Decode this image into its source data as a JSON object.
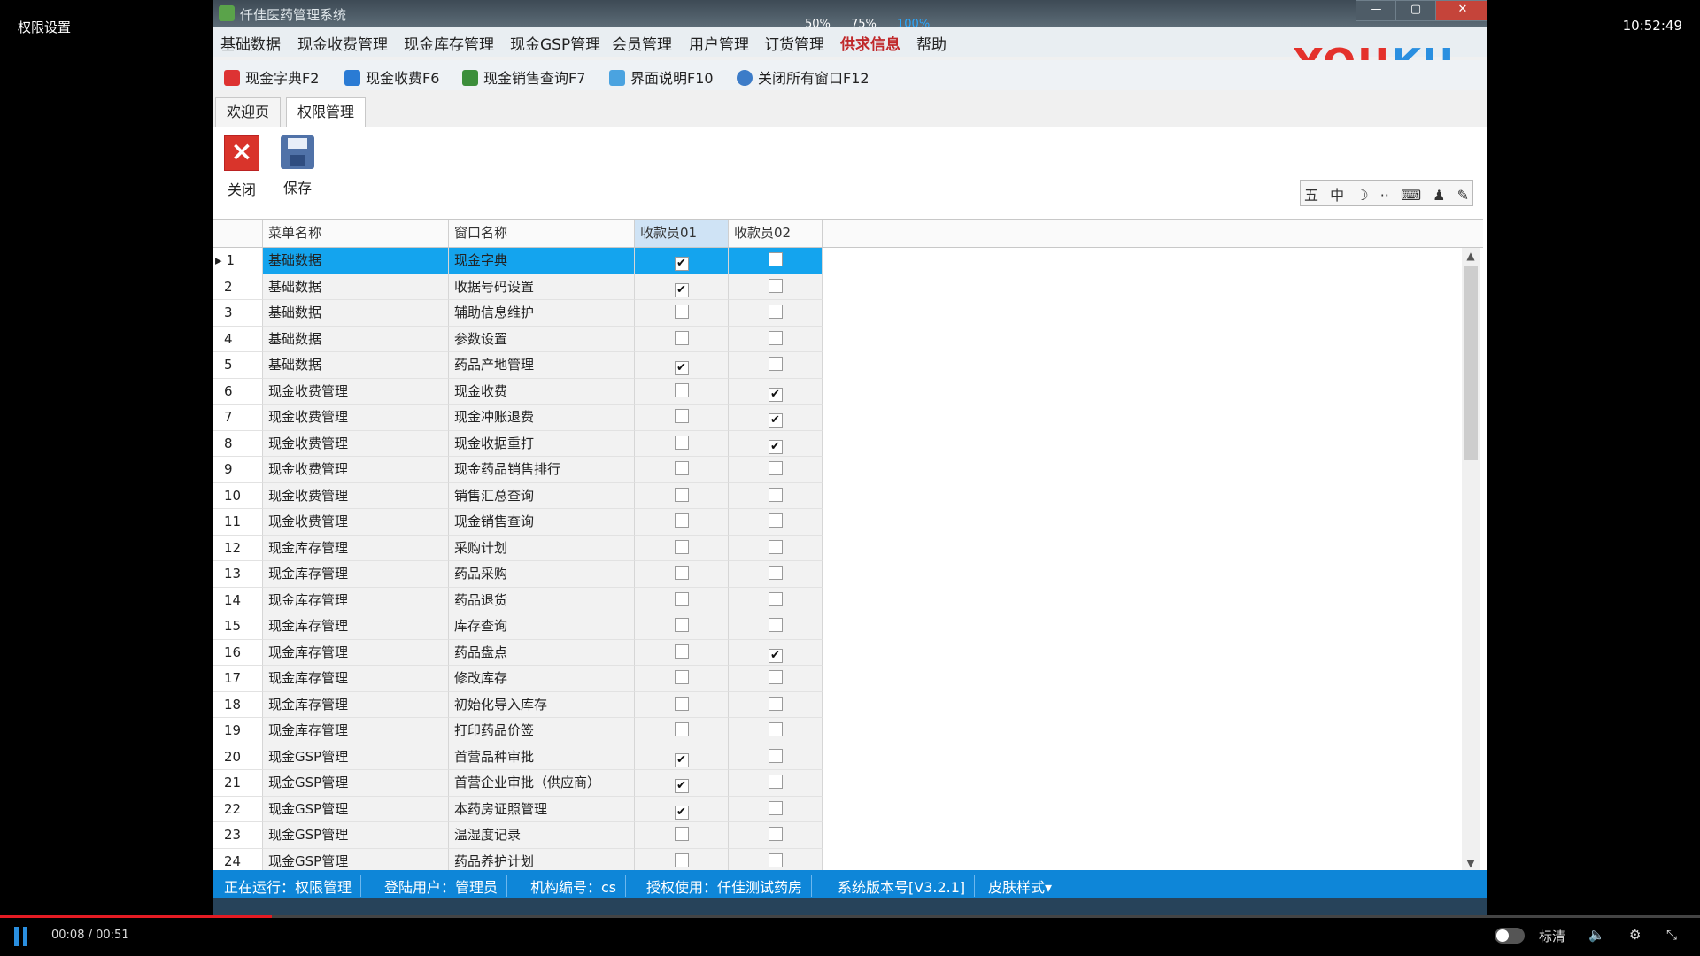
{
  "player": {
    "title": "权限设置",
    "clock": "10:52:49",
    "time": "00:08",
    "duration": "00:51",
    "quality": "标清",
    "progress": 0.16
  },
  "window": {
    "title": "仟佳医药管理系统",
    "zoom": [
      "50%",
      "75%",
      "100%"
    ],
    "controls": [
      "—",
      "▢",
      "✕"
    ]
  },
  "menu": [
    "基础数据",
    "现金收费管理",
    "现金库存管理",
    "现金GSP管理",
    "会员管理",
    "用户管理",
    "订货管理",
    "供求信息",
    "帮助"
  ],
  "brand": {
    "logo": "YOUKU",
    "colors": {
      "you": "#e4312b",
      "ku": "#2a8fe0"
    }
  },
  "quickbar": [
    {
      "label": "现金字典F2",
      "color": "#d33"
    },
    {
      "label": "现金收费F6",
      "color": "#2a7bd4"
    },
    {
      "label": "现金销售查询F7",
      "color": "#3b8e3b"
    },
    {
      "label": "界面说明F10",
      "color": "#4aa3e0"
    },
    {
      "label": "关闭所有窗口F12",
      "color": "#3c7cc8"
    }
  ],
  "tabs": [
    "欢迎页",
    "权限管理"
  ],
  "toolbar": {
    "close": "关闭",
    "save": "保存"
  },
  "ime": [
    "五",
    "中",
    "☽",
    "··",
    "⌨",
    "♟",
    "✎"
  ],
  "table": {
    "headers": [
      "菜单名称",
      "窗口名称",
      "收款员01",
      "收款员02"
    ],
    "rows": [
      {
        "n": "1",
        "menu": "基础数据",
        "win": "现金字典",
        "a": "✔",
        "b": ""
      },
      {
        "n": "2",
        "menu": "基础数据",
        "win": "收据号码设置",
        "a": "✔",
        "b": ""
      },
      {
        "n": "3",
        "menu": "基础数据",
        "win": "辅助信息维护",
        "a": "",
        "b": ""
      },
      {
        "n": "4",
        "menu": "基础数据",
        "win": "参数设置",
        "a": "",
        "b": ""
      },
      {
        "n": "5",
        "menu": "基础数据",
        "win": "药品产地管理",
        "a": "✔",
        "b": ""
      },
      {
        "n": "6",
        "menu": "现金收费管理",
        "win": "现金收费",
        "a": "",
        "b": "✔"
      },
      {
        "n": "7",
        "menu": "现金收费管理",
        "win": "现金冲账退费",
        "a": "",
        "b": "✔"
      },
      {
        "n": "8",
        "menu": "现金收费管理",
        "win": "现金收据重打",
        "a": "",
        "b": "✔"
      },
      {
        "n": "9",
        "menu": "现金收费管理",
        "win": "现金药品销售排行",
        "a": "",
        "b": ""
      },
      {
        "n": "10",
        "menu": "现金收费管理",
        "win": "销售汇总查询",
        "a": "",
        "b": ""
      },
      {
        "n": "11",
        "menu": "现金收费管理",
        "win": "现金销售查询",
        "a": "",
        "b": ""
      },
      {
        "n": "12",
        "menu": "现金库存管理",
        "win": "采购计划",
        "a": "",
        "b": ""
      },
      {
        "n": "13",
        "menu": "现金库存管理",
        "win": "药品采购",
        "a": "",
        "b": ""
      },
      {
        "n": "14",
        "menu": "现金库存管理",
        "win": "药品退货",
        "a": "",
        "b": ""
      },
      {
        "n": "15",
        "menu": "现金库存管理",
        "win": "库存查询",
        "a": "",
        "b": ""
      },
      {
        "n": "16",
        "menu": "现金库存管理",
        "win": "药品盘点",
        "a": "",
        "b": "✔"
      },
      {
        "n": "17",
        "menu": "现金库存管理",
        "win": "修改库存",
        "a": "",
        "b": ""
      },
      {
        "n": "18",
        "menu": "现金库存管理",
        "win": "初始化导入库存",
        "a": "",
        "b": ""
      },
      {
        "n": "19",
        "menu": "现金库存管理",
        "win": "打印药品价签",
        "a": "",
        "b": ""
      },
      {
        "n": "20",
        "menu": "现金GSP管理",
        "win": "首营品种审批",
        "a": "✔",
        "b": ""
      },
      {
        "n": "21",
        "menu": "现金GSP管理",
        "win": "首营企业审批（供应商）",
        "a": "✔",
        "b": ""
      },
      {
        "n": "22",
        "menu": "现金GSP管理",
        "win": "本药房证照管理",
        "a": "✔",
        "b": ""
      },
      {
        "n": "23",
        "menu": "现金GSP管理",
        "win": "温湿度记录",
        "a": "",
        "b": ""
      },
      {
        "n": "24",
        "menu": "现金GSP管理",
        "win": "药品养护计划",
        "a": "",
        "b": ""
      }
    ]
  },
  "status": [
    "正在运行：权限管理",
    "登陆用户：管理员",
    "机构编号：cs",
    "授权使用：仟佳测试药房",
    "系统版本号[V3.2.1]",
    "皮肤样式▾"
  ]
}
